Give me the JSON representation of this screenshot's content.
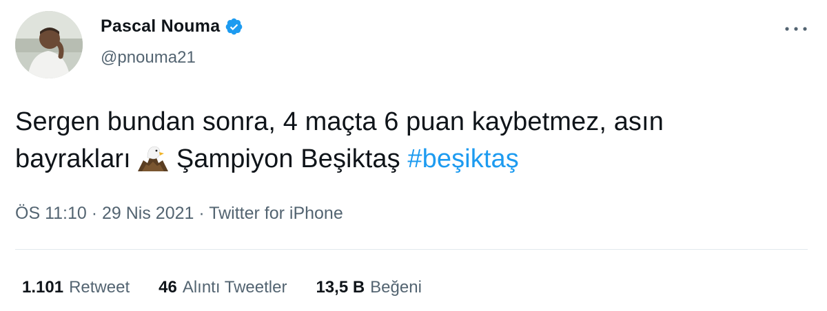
{
  "author": {
    "name": "Pascal Nouma",
    "handle": "@pnouma21",
    "verified": true
  },
  "tweet": {
    "line1": "Sergen bundan sonra, 4 maçta 6 puan kaybetmez, asın",
    "line2_before": "bayrakları",
    "emoji": "eagle-icon",
    "line2_after": "Şampiyon Beşiktaş",
    "hashtag": "#beşiktaş"
  },
  "meta": {
    "time": "ÖS 11:10",
    "separator1": " · ",
    "date": "29 Nis 2021",
    "separator2": " · ",
    "source": "Twitter for iPhone"
  },
  "stats": {
    "retweets": {
      "value": "1.101",
      "label": "Retweet"
    },
    "quotes": {
      "value": "46",
      "label": "Alıntı Tweetler"
    },
    "likes": {
      "value": "13,5 B",
      "label": "Beğeni"
    }
  },
  "colors": {
    "link": "#1d9bf0",
    "secondary_text": "#536471",
    "primary_text": "#0f1419",
    "divider": "#e1e8ed"
  }
}
